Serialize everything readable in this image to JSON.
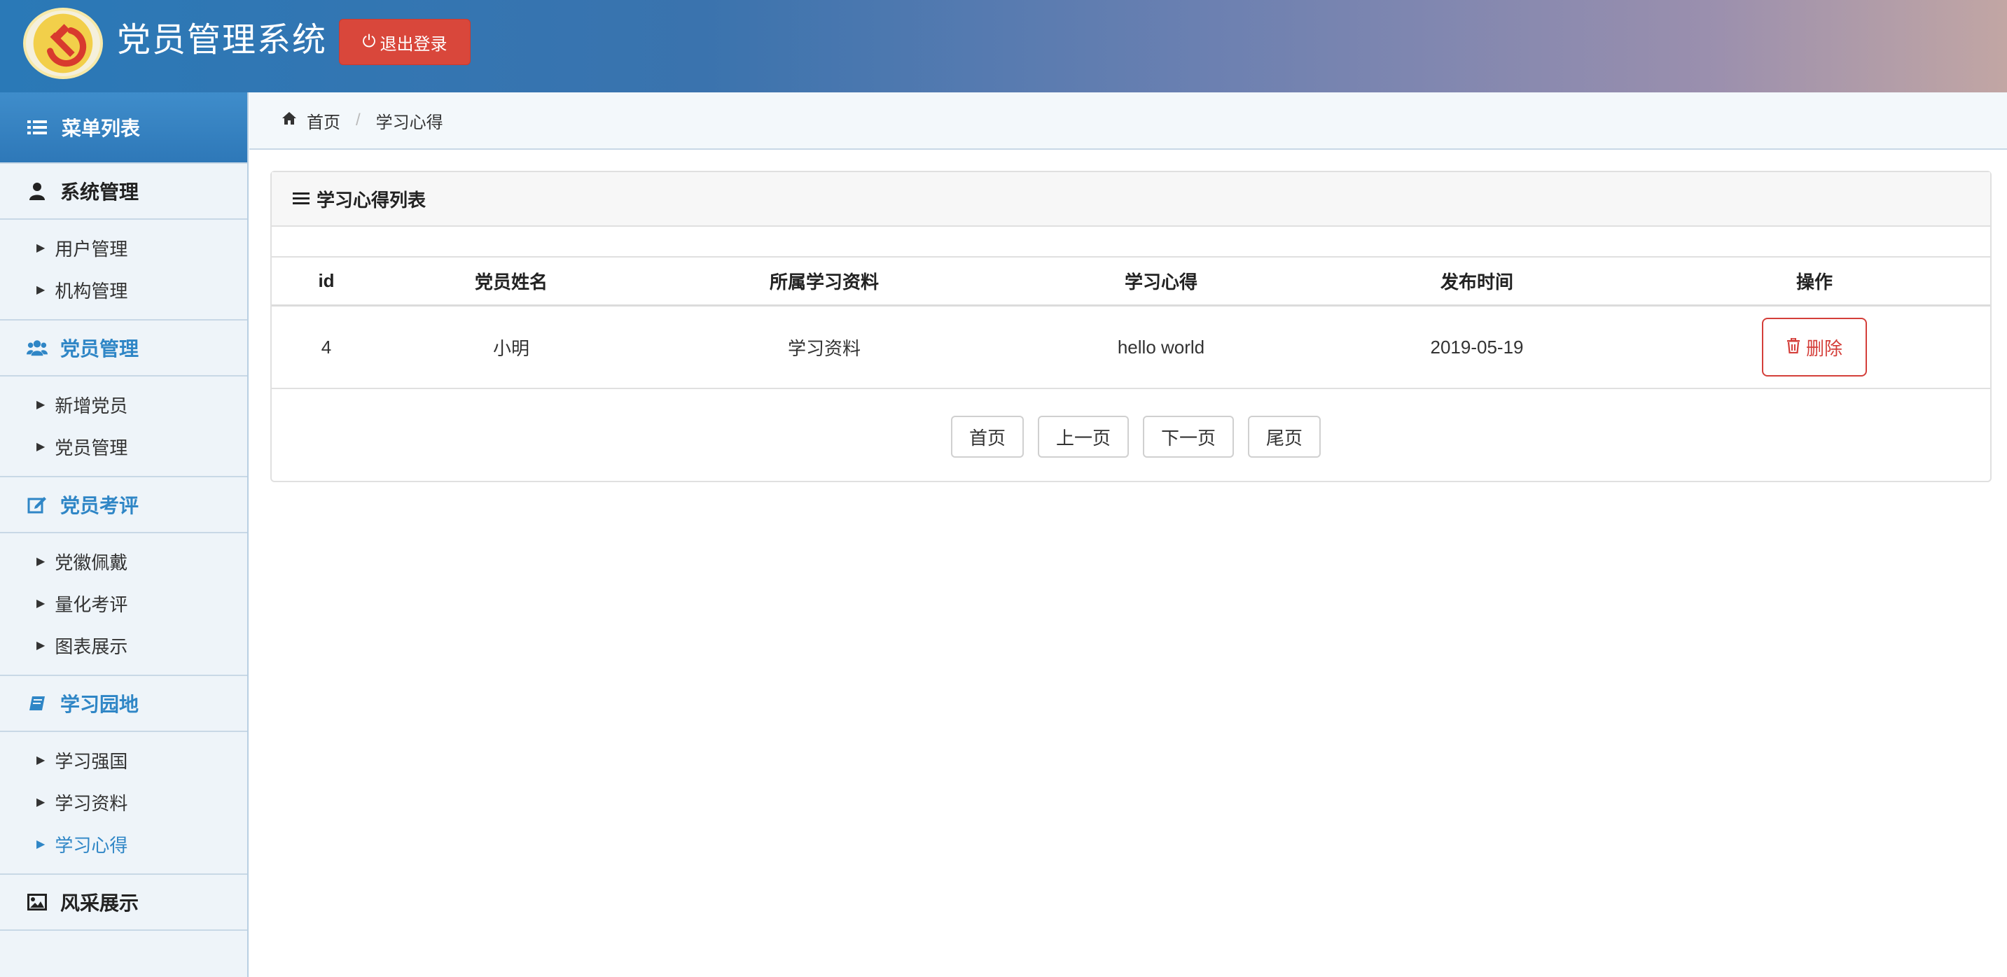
{
  "header": {
    "app_title": "党员管理系统",
    "logout_label": "退出登录"
  },
  "sidebar": {
    "menu_title": "菜单列表",
    "groups": [
      {
        "title": "系统管理",
        "icon": "user-icon",
        "items": [
          "用户管理",
          "机构管理"
        ]
      },
      {
        "title": "党员管理",
        "icon": "users-icon",
        "items": [
          "新增党员",
          "党员管理"
        ]
      },
      {
        "title": "党员考评",
        "icon": "edit-icon",
        "items": [
          "党徽佩戴",
          "量化考评",
          "图表展示"
        ]
      },
      {
        "title": "学习园地",
        "icon": "book-icon",
        "items": [
          "学习强国",
          "学习资料",
          "学习心得"
        ]
      },
      {
        "title": "风采展示",
        "icon": "image-icon",
        "items": []
      }
    ],
    "active_item": "学习心得"
  },
  "breadcrumb": {
    "home": "首页",
    "current": "学习心得"
  },
  "panel": {
    "title": "学习心得列表",
    "columns": [
      "id",
      "党员姓名",
      "所属学习资料",
      "学习心得",
      "发布时间",
      "操作"
    ],
    "rows": [
      {
        "id": "4",
        "name": "小明",
        "material": "学习资料",
        "note": "hello world",
        "date": "2019-05-19",
        "action": "删除"
      }
    ],
    "pager": [
      "首页",
      "上一页",
      "下一页",
      "尾页"
    ]
  },
  "colors": {
    "accent_blue": "#2f86c6",
    "danger_red": "#d9473b"
  }
}
